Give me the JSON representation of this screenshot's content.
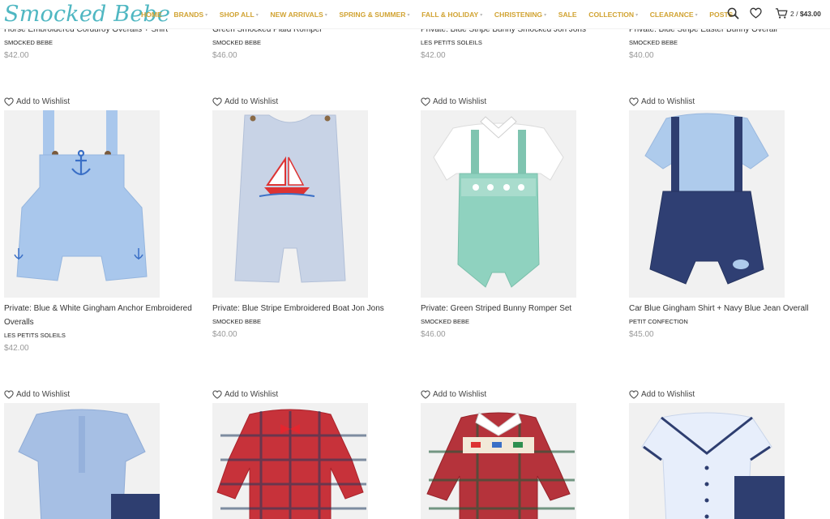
{
  "site": {
    "logo": "Smocked Bebe"
  },
  "nav": [
    {
      "label": "Home",
      "chevron": false
    },
    {
      "label": "Brands",
      "chevron": true
    },
    {
      "label": "Shop All",
      "chevron": true
    },
    {
      "label": "New Arrivals",
      "chevron": true
    },
    {
      "label": "Spring & Summer",
      "chevron": true
    },
    {
      "label": "Fall & Holiday",
      "chevron": true
    },
    {
      "label": "Christening",
      "chevron": true
    },
    {
      "label": "Sale",
      "chevron": false
    },
    {
      "label": "Collection",
      "chevron": true
    },
    {
      "label": "Clearance",
      "chevron": true
    },
    {
      "label": "Posts",
      "chevron": true
    }
  ],
  "header_icons": {
    "search": "search-icon",
    "wishlist": "heart-icon",
    "cart": "cart-icon"
  },
  "cart": {
    "count": "2 /",
    "total": "$43.00"
  },
  "wishlist_label": "Add to Wishlist",
  "products_top": [
    {
      "title": "Horse Embroidered Corduroy Overalls + Shirt",
      "brand": "Smocked Bebe",
      "price": "$42.00"
    },
    {
      "title": "Green Smocked Plaid Romper",
      "brand": "Smocked Bebe",
      "price": "$46.00"
    },
    {
      "title": "Private: Blue Stripe Bunny Smocked Jon Jons",
      "brand": "Les Petits Soleils",
      "price": "$42.00"
    },
    {
      "title": "Private: Blue Stripe Easter Bunny Overall",
      "brand": "Smocked Bebe",
      "price": "$40.00"
    }
  ],
  "products_mid": [
    {
      "title": "Private: Blue & White Gingham Anchor Embroidered Overalls",
      "brand": "Les Petits Soleils",
      "price": "$42.00"
    },
    {
      "title": "Private: Blue Stripe Embroidered Boat Jon Jons",
      "brand": "Smocked Bebe",
      "price": "$40.00"
    },
    {
      "title": "Private: Green Striped Bunny Romper Set",
      "brand": "Smocked Bebe",
      "price": "$46.00"
    },
    {
      "title": "Car Blue Gingham Shirt + Navy Blue Jean Overall",
      "brand": "Petit Confection",
      "price": "$45.00"
    }
  ],
  "colors": {
    "logo": "#4fb7c2",
    "nav": "#d1a332",
    "price": "#999999"
  }
}
